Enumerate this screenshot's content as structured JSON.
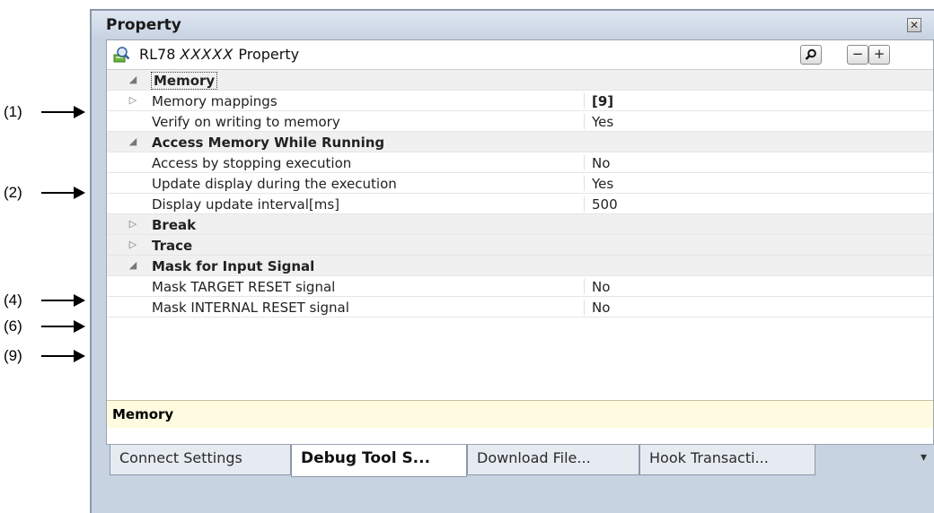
{
  "callouts": [
    "(1)",
    "(2)",
    "(4)",
    "(6)",
    "(9)"
  ],
  "window": {
    "title": "Property",
    "close_glyph": "✕"
  },
  "panel": {
    "title_prefix": "RL78",
    "title_italic": "XXXXX",
    "title_suffix": "Property",
    "icon": "property-icon",
    "buttons": {
      "search": "search-icon",
      "collapse": "−",
      "expand": "+"
    }
  },
  "rows": [
    {
      "kind": "category",
      "toggle": "◢",
      "name": "Memory",
      "value": ""
    },
    {
      "kind": "item",
      "toggle": "▷",
      "name": "Memory mappings",
      "value": "[9]",
      "bold_value": true
    },
    {
      "kind": "item",
      "toggle": "",
      "name": "Verify on writing to memory",
      "value": "Yes"
    },
    {
      "kind": "category",
      "toggle": "◢",
      "name": "Access Memory While Running",
      "value": ""
    },
    {
      "kind": "item",
      "toggle": "",
      "name": "Access by stopping execution",
      "value": "No"
    },
    {
      "kind": "item",
      "toggle": "",
      "name": "Update display during the execution",
      "value": "Yes"
    },
    {
      "kind": "item",
      "toggle": "",
      "name": "Display update interval[ms]",
      "value": "500"
    },
    {
      "kind": "category",
      "toggle": "▷",
      "name": "Break",
      "value": ""
    },
    {
      "kind": "category",
      "toggle": "▷",
      "name": "Trace",
      "value": ""
    },
    {
      "kind": "category",
      "toggle": "◢",
      "name": "Mask for Input Signal",
      "value": ""
    },
    {
      "kind": "item",
      "toggle": "",
      "name": "Mask TARGET RESET signal",
      "value": "No"
    },
    {
      "kind": "item",
      "toggle": "",
      "name": "Mask INTERNAL RESET signal",
      "value": "No"
    }
  ],
  "description": "Memory",
  "tabs": [
    "Connect Settings",
    "Debug Tool S...",
    "Download File...",
    "Hook Transacti..."
  ],
  "active_tab": 1,
  "tab_menu_glyph": "▾"
}
